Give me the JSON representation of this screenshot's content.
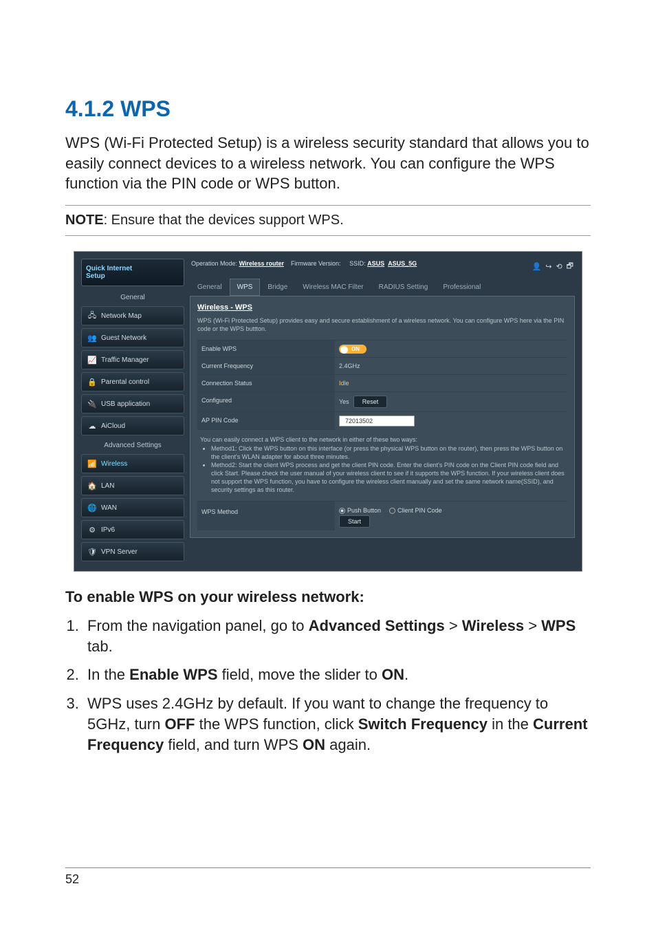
{
  "heading": "4.1.2 WPS",
  "intro": "WPS (Wi-Fi Protected Setup) is a wireless security standard that allows you to easily connect devices to a wireless network. You can configure the WPS function via the PIN code or WPS button.",
  "note_label": "NOTE",
  "note_text": ":  Ensure that the devices support WPS.",
  "screenshot": {
    "qis_line1": "Quick Internet",
    "qis_line2": "Setup",
    "nav_general_head": "General",
    "nav": [
      {
        "icon": "🖧",
        "label": "Network Map"
      },
      {
        "icon": "👥",
        "label": "Guest Network"
      },
      {
        "icon": "📈",
        "label": "Traffic Manager"
      },
      {
        "icon": "🔒",
        "label": "Parental control"
      },
      {
        "icon": "🔌",
        "label": "USB application"
      },
      {
        "icon": "☁",
        "label": "AiCloud"
      }
    ],
    "nav_adv_head": "Advanced Settings",
    "nav_adv": [
      {
        "icon": "📶",
        "label": "Wireless",
        "active": true
      },
      {
        "icon": "🏠",
        "label": "LAN"
      },
      {
        "icon": "🌐",
        "label": "WAN"
      },
      {
        "icon": "⚙",
        "label": "IPv6"
      },
      {
        "icon": "🛡",
        "label": "VPN Server"
      }
    ],
    "opmode_label": "Operation Mode:",
    "opmode_value": "Wireless router",
    "fw_label": "Firmware Version:",
    "ssid_label": "SSID:",
    "ssid1": "ASUS",
    "ssid2": "ASUS_5G",
    "tabs": [
      "General",
      "WPS",
      "Bridge",
      "Wireless MAC Filter",
      "RADIUS Setting",
      "Professional"
    ],
    "panel_title": "Wireless - WPS",
    "panel_desc": "WPS (Wi-Fi Protected Setup) provides easy and secure establishment of a wireless network. You can configure WPS here via the PIN code or the WPS buttton.",
    "rows": {
      "enable_label": "Enable WPS",
      "enable_value": "ON",
      "freq_label": "Current Frequency",
      "freq_value": "2.4GHz",
      "conn_label": "Connection Status",
      "conn_value": "Idle",
      "conf_label": "Configured",
      "conf_value": "Yes",
      "reset_btn": "Reset",
      "pin_label": "AP PIN Code",
      "pin_value": "72013502"
    },
    "methods_head": "You can easily connect a WPS client to the network in either of these two ways:",
    "method1": "Method1: Click the WPS button on this interface (or press the physical WPS button on the router), then press the WPS button on the client's WLAN adapter for about three minutes.",
    "method2": "Method2: Start the client WPS process and get the client PIN code. Enter the client's PIN code on the Client PIN code field and click Start. Please check the user manual of your wireless client to see if it supports the WPS function. If your wireless client does not support the WPS function, you have to configure the wireless client manually and set the same network name(SSID), and security settings as this router.",
    "wpsmethod_label": "WPS Method",
    "radio1": "Push Button",
    "radio2": "Client PIN Code",
    "start_btn": "Start"
  },
  "subheading": "To enable WPS on your wireless network:",
  "step1_a": "From the navigation panel, go to ",
  "step1_b": "Advanced Settings",
  "step1_c": " > ",
  "step1_d": "Wireless",
  "step1_e": " > ",
  "step1_f": "WPS",
  "step1_g": " tab.",
  "step2_a": "In the ",
  "step2_b": "Enable WPS",
  "step2_c": " field, move the slider to ",
  "step2_d": "ON",
  "step2_e": ".",
  "step3_a": "WPS uses 2.4GHz by default. If you want to change the frequency to 5GHz, turn ",
  "step3_b": "OFF",
  "step3_c": " the WPS function, click ",
  "step3_d": "Switch Frequency",
  "step3_e": " in the ",
  "step3_f": "Current Frequency",
  "step3_g": " field, and turn WPS ",
  "step3_h": "ON",
  "step3_i": " again.",
  "page_number": "52"
}
